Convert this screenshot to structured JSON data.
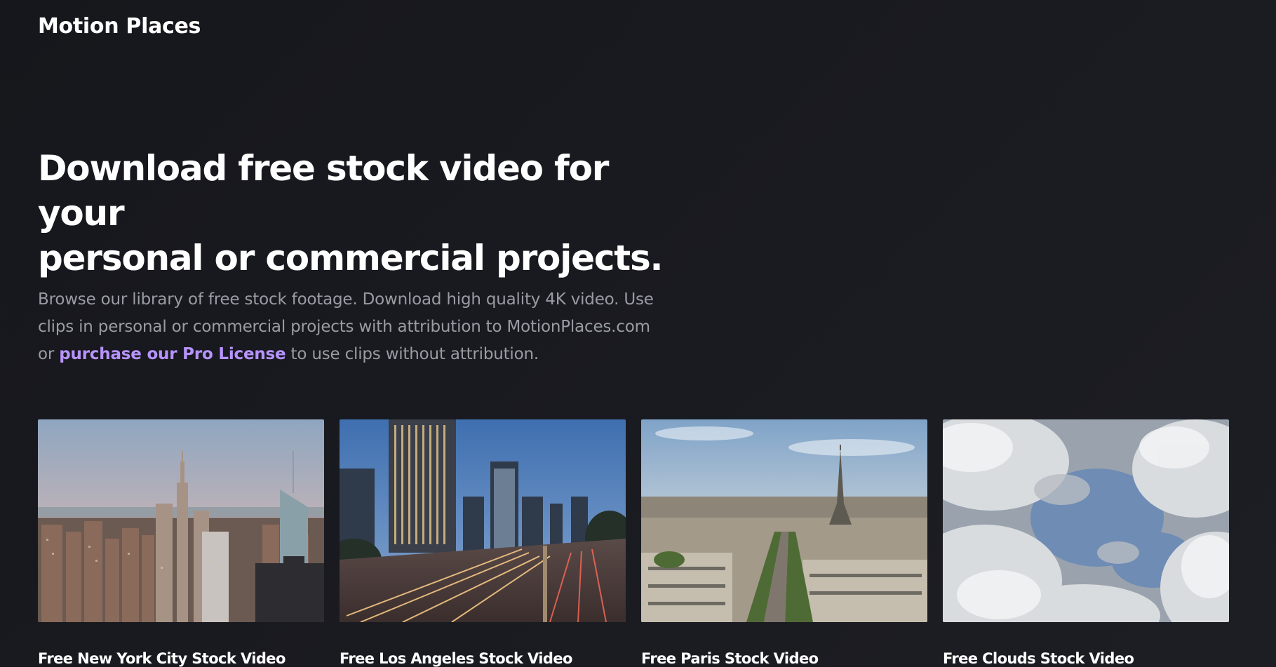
{
  "header": {
    "logo": "Motion Places"
  },
  "hero": {
    "title_line1": "Download free stock video for your",
    "title_line2": "personal or commercial projects.",
    "desc_part1": "Browse our library of free stock footage. Download high quality 4K video. Use clips in personal or commercial projects with attribution to MotionPlaces.com or ",
    "pro_link": "purchase our Pro License",
    "desc_part2": " to use clips without attribution."
  },
  "cards": [
    {
      "title": "Free New York City Stock Video",
      "thumb": "new-york-skyline-image"
    },
    {
      "title": "Free Los Angeles Stock Video",
      "thumb": "los-angeles-freeway-image"
    },
    {
      "title": "Free Paris Stock Video",
      "thumb": "paris-eiffel-tower-image"
    },
    {
      "title": "Free Clouds Stock Video",
      "thumb": "clouds-sky-image"
    }
  ],
  "colors": {
    "background": "#18191e",
    "text": "#ffffff",
    "muted": "#9a9ca4",
    "accent": "#b793ff"
  }
}
